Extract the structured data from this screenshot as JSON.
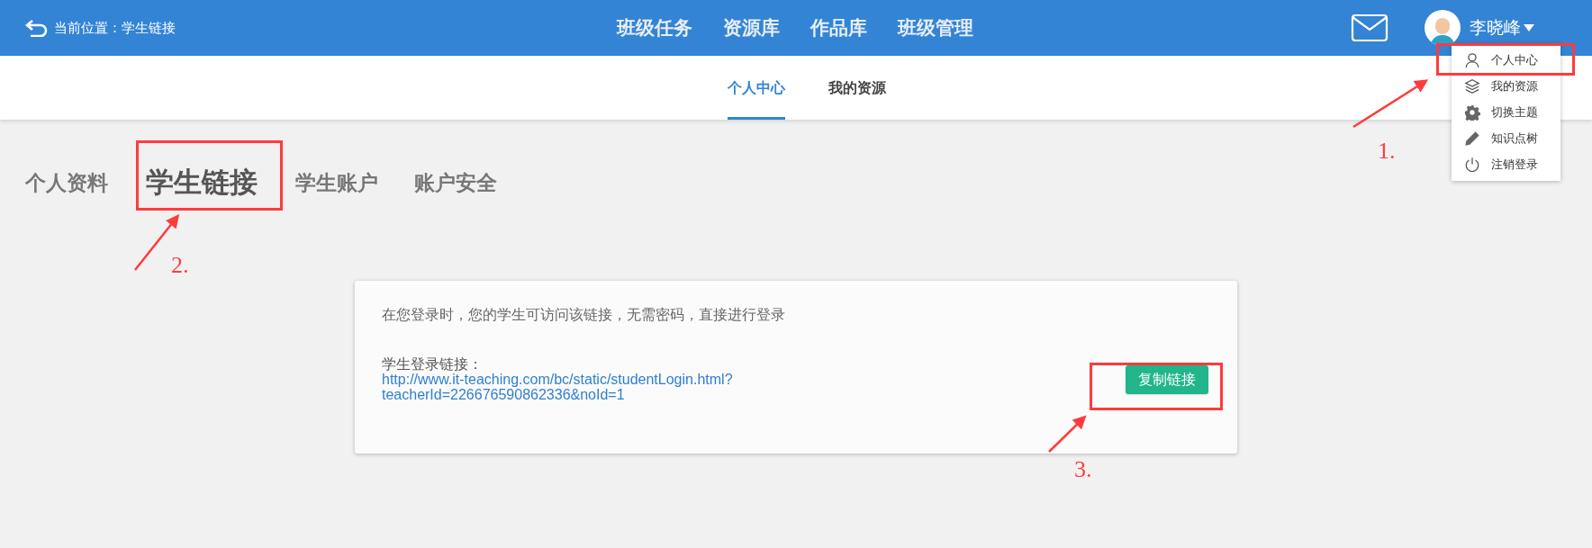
{
  "header": {
    "breadcrumb": "当前位置：学生链接",
    "nav": [
      "班级任务",
      "资源库",
      "作品库",
      "班级管理"
    ],
    "user_name": "李晓峰"
  },
  "user_menu": [
    {
      "kind": "person",
      "label": "个人中心"
    },
    {
      "kind": "layers",
      "label": "我的资源"
    },
    {
      "kind": "gear",
      "label": "切换主题"
    },
    {
      "kind": "pencil",
      "label": "知识点树"
    },
    {
      "kind": "power",
      "label": "注销登录"
    }
  ],
  "sub_tabs": [
    {
      "label": "个人中心",
      "selected": true
    },
    {
      "label": "我的资源",
      "selected": false
    }
  ],
  "profile_tabs": [
    {
      "label": "个人资料",
      "selected": false
    },
    {
      "label": "学生链接",
      "selected": true
    },
    {
      "label": "学生账户",
      "selected": false
    },
    {
      "label": "账户安全",
      "selected": false
    }
  ],
  "card": {
    "description": "在您登录时，您的学生可访问该链接，无需密码，直接进行登录",
    "link_label": "学生登录链接：",
    "link_lines": [
      "http://www.it-teaching.com/bc/static/studentLogin.html?",
      "teacherId=226676590862336&noId=1"
    ],
    "button": "复制链接"
  },
  "annotations": [
    "1.",
    "2.",
    "3."
  ]
}
